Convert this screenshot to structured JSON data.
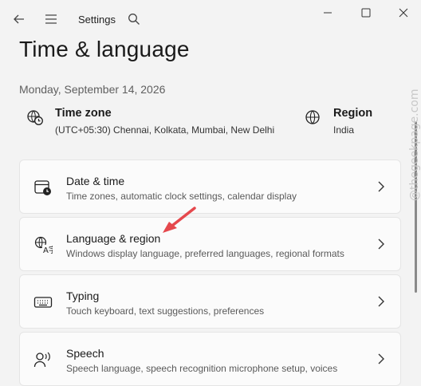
{
  "window": {
    "title": "Settings",
    "icons": [
      "back-icon",
      "menu-icon",
      "search-icon",
      "minimize-icon",
      "maximize-icon",
      "close-icon"
    ]
  },
  "page": {
    "title": "Time & language",
    "date": "Monday, September 14, 2026"
  },
  "time_zone": {
    "label": "Time zone",
    "value": "(UTC+05:30) Chennai, Kolkata, Mumbai, New Delhi",
    "icon": "clock-globe-icon"
  },
  "region": {
    "label": "Region",
    "value": "India",
    "icon": "globe-icon"
  },
  "cards": [
    {
      "title": "Date & time",
      "description": "Time zones, automatic clock settings, calendar display",
      "icon": "calendar-clock-icon"
    },
    {
      "title": "Language & region",
      "description": "Windows display language, preferred languages, regional formats",
      "icon": "language-icon"
    },
    {
      "title": "Typing",
      "description": "Touch keyboard, text suggestions, preferences",
      "icon": "keyboard-icon"
    },
    {
      "title": "Speech",
      "description": "Speech language, speech recognition microphone setup, voices",
      "icon": "speech-icon"
    }
  ],
  "watermark": "@thegeekpage.com",
  "colors": {
    "background": "#f3f3f3",
    "card": "#fbfbfb",
    "annotation_arrow": "#e5484d"
  }
}
